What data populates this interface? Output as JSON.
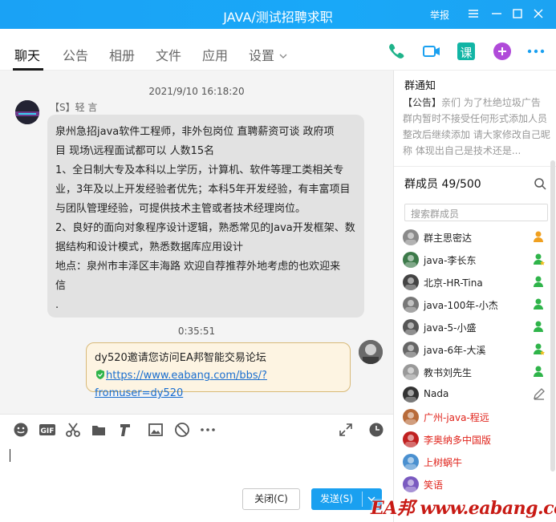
{
  "window": {
    "title": "JAVA/测试招聘求职",
    "report_label": "举报"
  },
  "tabs": [
    {
      "label": "聊天",
      "active": true
    },
    {
      "label": "公告"
    },
    {
      "label": "相册"
    },
    {
      "label": "文件"
    },
    {
      "label": "应用"
    },
    {
      "label": "设置"
    }
  ],
  "tab_icons": [
    "phone-icon",
    "video-icon",
    "lesson-icon",
    "add-icon",
    "more-icon"
  ],
  "lesson_icon_label": "课",
  "chat": {
    "timestamp1": "2021/9/10 16:18:20",
    "sender": "【S】轻 言",
    "message_lines": [
      "泉州急招java软件工程师，非外包岗位 直聘薪资可谈  政府项",
      "目   现场\\远程面试都可以  人数15名",
      " 1、全日制大专及本科以上学历，计算机、软件等理工类相关专",
      "业，3年及以上开发经验者优先；本科5年开发经验，有丰富项目",
      "与团队管理经验，可提供技术主管或者技术经理岗位。",
      "2、良好的面向对象程序设计逻辑，熟悉常见的Java开发框架、数",
      "据结构和设计模式，熟悉数据库应用设计",
      "地点：泉州市丰泽区丰海路     欢迎自荐推荐外地考虑的也欢迎来",
      "信",
      "  ."
    ],
    "timestamp2": "0:35:51",
    "self_message": "dy520邀请您访问EA邦智能交易论坛",
    "self_link": "https://www.eabang.com/bbs/?fromuser=dy520"
  },
  "input": {
    "close_label": "关闭(C)",
    "send_label": "发送(S)"
  },
  "group": {
    "notice_title": "群通知",
    "notice_tag": "【公告】",
    "notice_text": "亲们 为了杜绝垃圾广告 群内暂时不接受任何形式添加人员 整改后继续添加 请大家修改自己昵称 体现出自己是技术还是...",
    "members_title": "群成员 49/500",
    "search_placeholder": "搜索群成员",
    "members": [
      {
        "name": "群主思密达",
        "red": false,
        "badge": "owner"
      },
      {
        "name": "java-李长东",
        "red": false,
        "badge": "admin"
      },
      {
        "name": "北京-HR-Tina",
        "red": false,
        "badge": "member"
      },
      {
        "name": "java-100年-小杰",
        "red": false,
        "badge": "member"
      },
      {
        "name": "java-5-小盛",
        "red": false,
        "badge": "member"
      },
      {
        "name": "java-6年-大溪",
        "red": false,
        "badge": "admin"
      },
      {
        "name": "教书刘先生",
        "red": false,
        "badge": "member"
      },
      {
        "name": "Nada",
        "red": false,
        "badge": "edit"
      },
      {
        "name": "广州-java-程远",
        "red": true,
        "badge": ""
      },
      {
        "name": "李奥纳多中国版",
        "red": true,
        "badge": ""
      },
      {
        "name": "上树蜗牛",
        "red": true,
        "badge": ""
      },
      {
        "name": "笑语",
        "red": true,
        "badge": ""
      }
    ]
  },
  "watermark": "EA邦 www.eabang.com",
  "colors": {
    "titlebar": "#1aa2f5",
    "accent_green": "#1fb38a",
    "lesson_teal": "#12b5a5",
    "add_purple": "#b04ad9",
    "red_name": "#e0231b"
  }
}
